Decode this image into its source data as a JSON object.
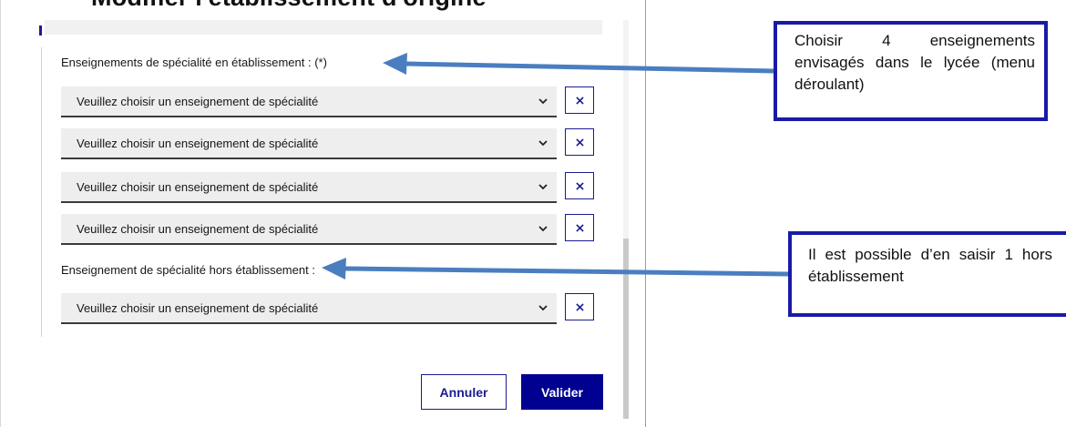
{
  "page_heading_partial": "Modifier l'établissement d'origine",
  "sections": {
    "in_school_label": "Enseignements de spécialité en établissement : (*)",
    "out_school_label": "Enseignement de spécialité hors établissement :"
  },
  "selects": [
    {
      "value": "Veuillez choisir un enseignement de spécialité"
    },
    {
      "value": "Veuillez choisir un enseignement de spécialité"
    },
    {
      "value": "Veuillez choisir un enseignement de spécialité"
    },
    {
      "value": "Veuillez choisir un enseignement de spécialité"
    },
    {
      "value": "Veuillez choisir un enseignement de spécialité"
    }
  ],
  "remove_symbol": "×",
  "buttons": {
    "cancel": "Annuler",
    "submit": "Valider"
  },
  "callouts": {
    "choose_four": "Choisir 4 enseignements envisagés dans le lycée (menu déroulant)",
    "one_outside": "Il est possible d’en saisir 1 hors établissement"
  },
  "colors": {
    "accent": "#000091",
    "callout_border": "#1a1aa8",
    "arrow": "#4a7ec0"
  }
}
